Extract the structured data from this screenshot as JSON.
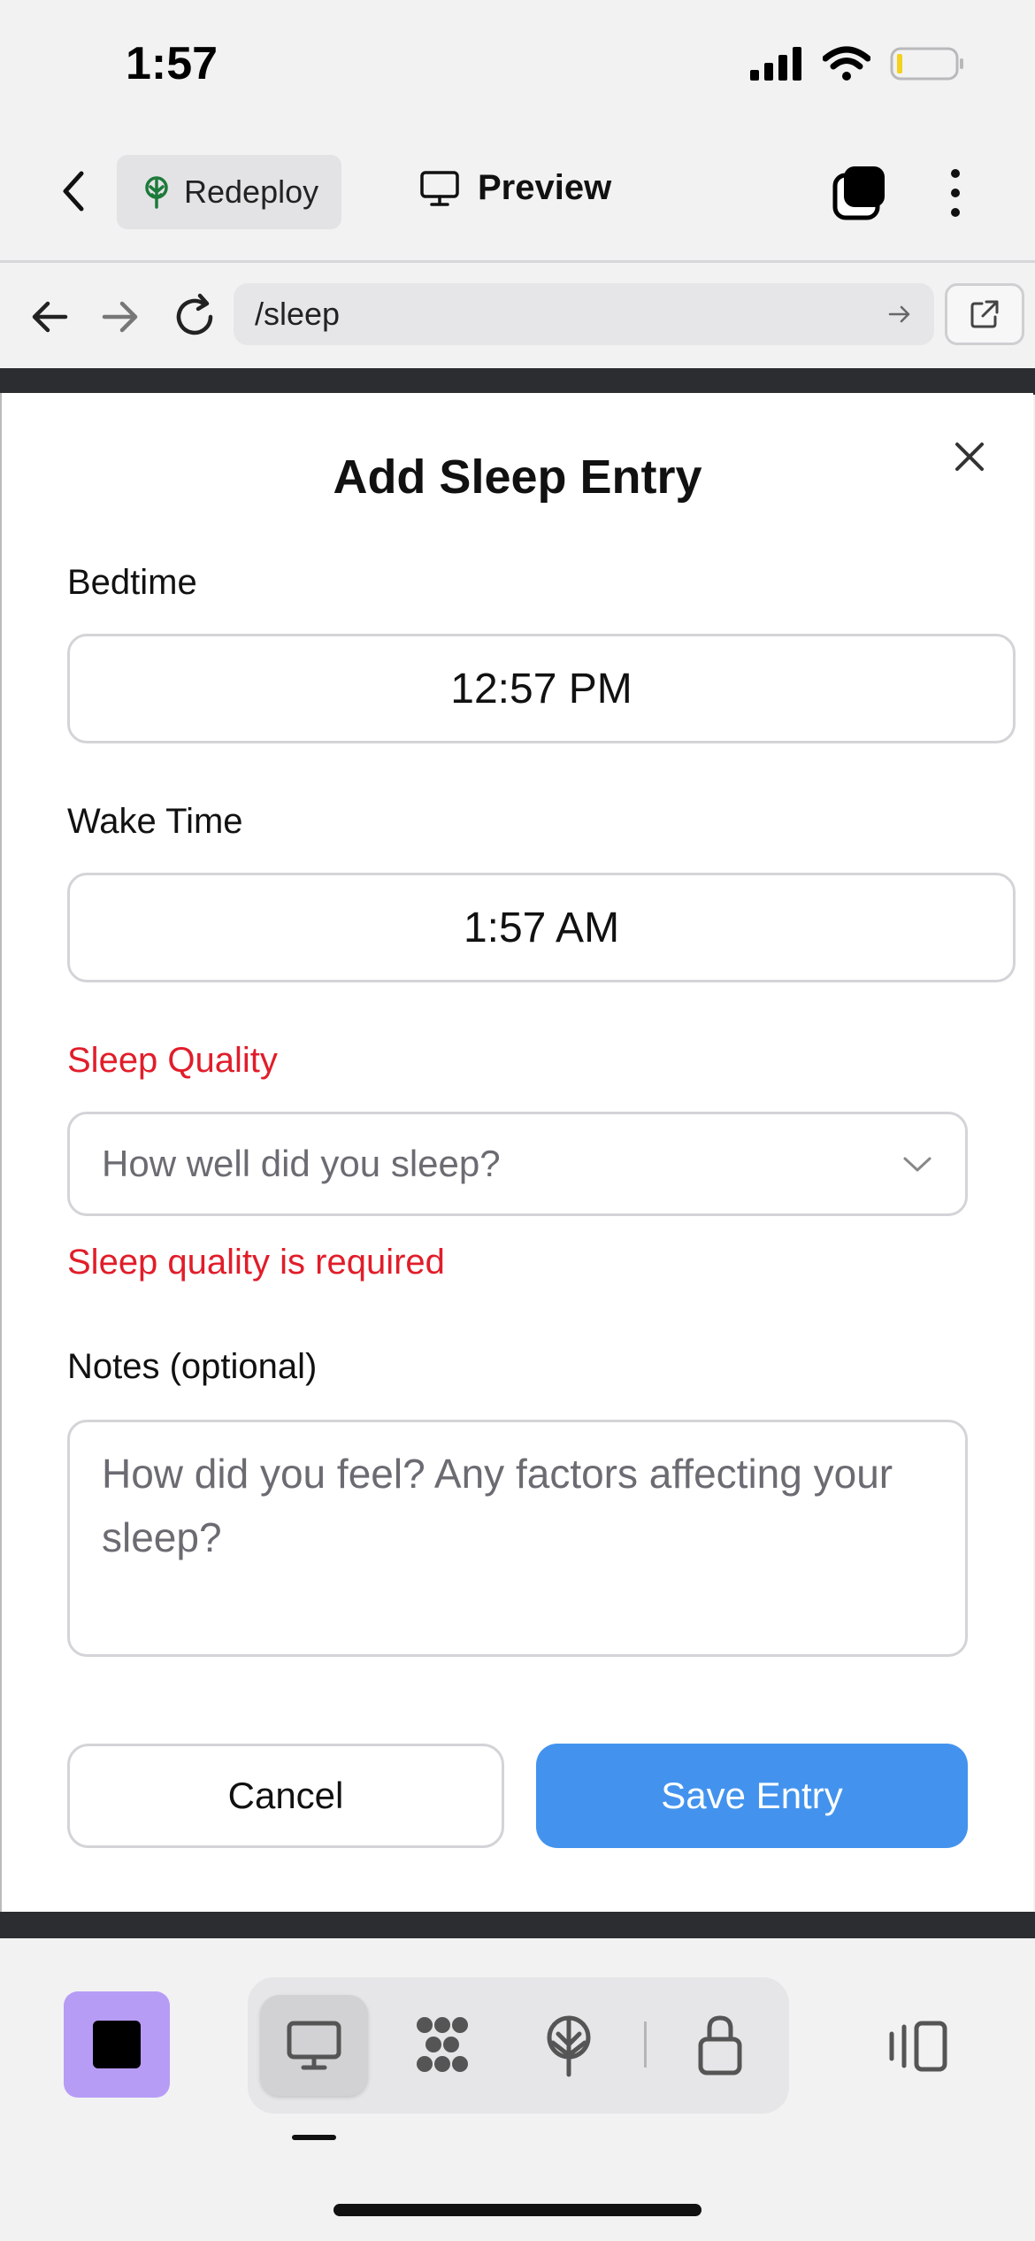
{
  "status_bar": {
    "time": "1:57"
  },
  "top_bar": {
    "redeploy_label": "Redeploy",
    "preview_label": "Preview"
  },
  "browser": {
    "url": "/sleep"
  },
  "modal": {
    "title": "Add Sleep Entry",
    "bedtime_label": "Bedtime",
    "bedtime_value": "12:57 PM",
    "wake_label": "Wake Time",
    "wake_value": "1:57 AM",
    "quality_label": "Sleep Quality",
    "quality_placeholder": "How well did you sleep?",
    "quality_error": "Sleep quality is required",
    "notes_label": "Notes (optional)",
    "notes_placeholder": "How did you feel? Any factors affecting your sleep?",
    "cancel_label": "Cancel",
    "save_label": "Save Entry"
  },
  "colors": {
    "accent": "#4393ee",
    "error": "#e11d2a",
    "stop_button": "#b79cf6"
  },
  "icons": [
    "back-chevron-icon",
    "tree-icon",
    "monitor-icon",
    "tabs-icon",
    "more-vertical-icon",
    "arrow-left-icon",
    "arrow-right-icon",
    "reload-icon",
    "external-link-icon",
    "close-icon",
    "chevron-down-icon",
    "stop-icon",
    "grid-icon",
    "antenna-icon",
    "lock-icon",
    "panel-icon"
  ]
}
